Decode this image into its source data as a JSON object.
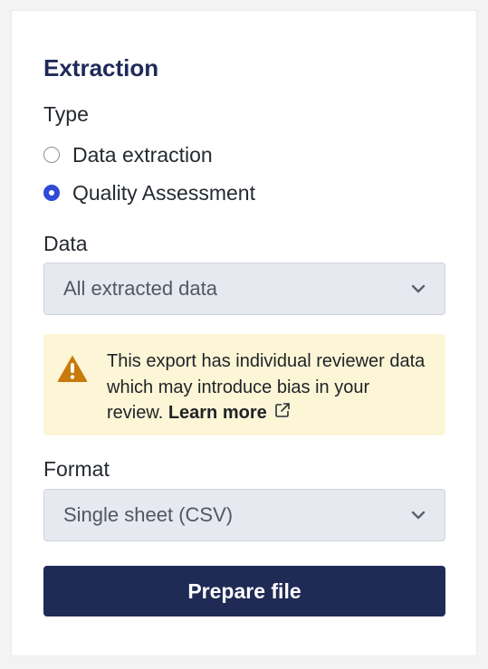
{
  "panel": {
    "title": "Extraction"
  },
  "type_section": {
    "label": "Type",
    "options": [
      {
        "label": "Data extraction",
        "selected": false
      },
      {
        "label": "Quality Assessment",
        "selected": true
      }
    ]
  },
  "data_section": {
    "label": "Data",
    "selected_value": "All extracted data"
  },
  "warning": {
    "text": "This export has individual reviewer data which may introduce bias in your review.",
    "link_text": "Learn more",
    "icon": "warning-triangle-icon",
    "link_icon": "external-link-icon"
  },
  "format_section": {
    "label": "Format",
    "selected_value": "Single sheet (CSV)"
  },
  "actions": {
    "prepare_label": "Prepare file"
  },
  "colors": {
    "title": "#1f2a5a",
    "accent": "#2f4bd5",
    "button": "#1f2a55",
    "warning_bg": "#fcf5d6",
    "warning_icon": "#c97a0a",
    "select_bg": "#e6e9f0"
  }
}
